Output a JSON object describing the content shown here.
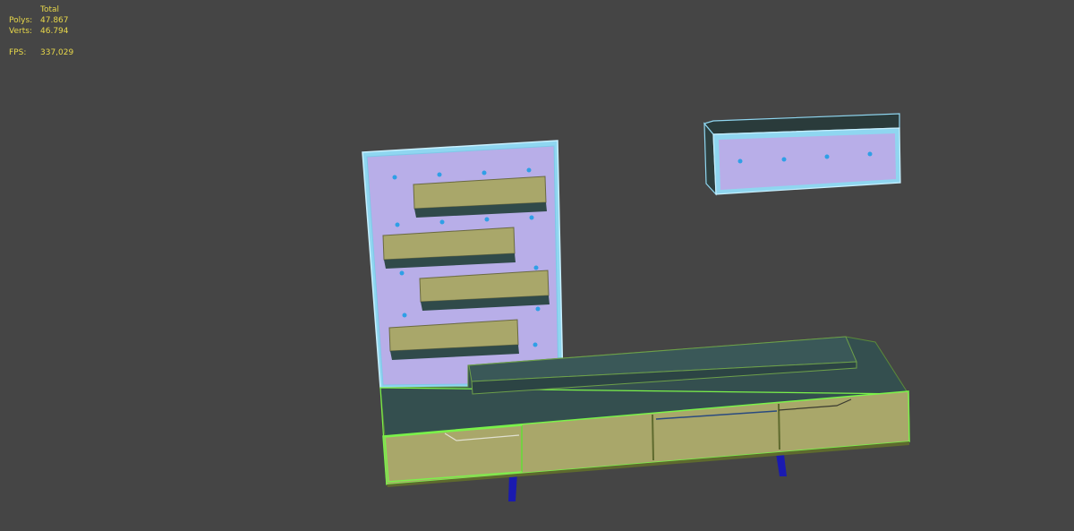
{
  "stats": {
    "header": "Total",
    "polys_label": "Polys:",
    "polys_value": "47.867",
    "verts_label": "Verts:",
    "verts_value": "46.794",
    "fps_label": "FPS:",
    "fps_value": "337,029"
  },
  "colors": {
    "background": "#454545",
    "stats_text": "#e8d84a",
    "panel_face": "#b8aee8",
    "panel_frame": "#8fd6f0",
    "shelf_face": "#a9a76a",
    "cabinet_top": "#344f4f",
    "selection_edge": "#7bf24a",
    "legs": "#1a1ab0",
    "dots": "#2f9fe6"
  },
  "viewport": {
    "objects": [
      "wall-panel",
      "wall-cabinet",
      "tv-stand"
    ]
  }
}
